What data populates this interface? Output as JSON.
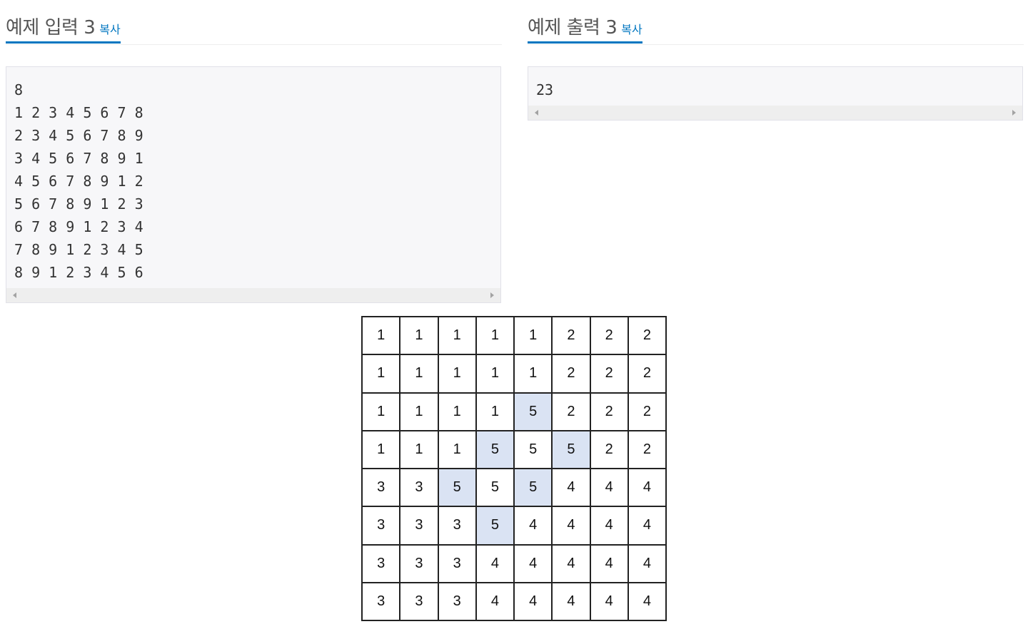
{
  "sample_input": {
    "title": "예제 입력 3",
    "copy_label": "복사",
    "text": "8\n1 2 3 4 5 6 7 8\n2 3 4 5 6 7 8 9\n3 4 5 6 7 8 9 1\n4 5 6 7 8 9 1 2\n5 6 7 8 9 1 2 3\n6 7 8 9 1 2 3 4\n7 8 9 1 2 3 4 5\n8 9 1 2 3 4 5 6"
  },
  "sample_output": {
    "title": "예제 출력 3",
    "copy_label": "복사",
    "text": "23"
  },
  "figure": {
    "highlight_color": "#dae3f3",
    "rows": [
      [
        "1",
        "1",
        "1",
        "1",
        "1",
        "2",
        "2",
        "2"
      ],
      [
        "1",
        "1",
        "1",
        "1",
        "1",
        "2",
        "2",
        "2"
      ],
      [
        "1",
        "1",
        "1",
        "1",
        "5",
        "2",
        "2",
        "2"
      ],
      [
        "1",
        "1",
        "1",
        "5",
        "5",
        "5",
        "2",
        "2"
      ],
      [
        "3",
        "3",
        "5",
        "5",
        "5",
        "4",
        "4",
        "4"
      ],
      [
        "3",
        "3",
        "3",
        "5",
        "4",
        "4",
        "4",
        "4"
      ],
      [
        "3",
        "3",
        "3",
        "4",
        "4",
        "4",
        "4",
        "4"
      ],
      [
        "3",
        "3",
        "3",
        "4",
        "4",
        "4",
        "4",
        "4"
      ]
    ],
    "highlighted": [
      [
        2,
        4
      ],
      [
        3,
        3
      ],
      [
        3,
        5
      ],
      [
        4,
        2
      ],
      [
        4,
        4
      ],
      [
        5,
        3
      ]
    ]
  }
}
